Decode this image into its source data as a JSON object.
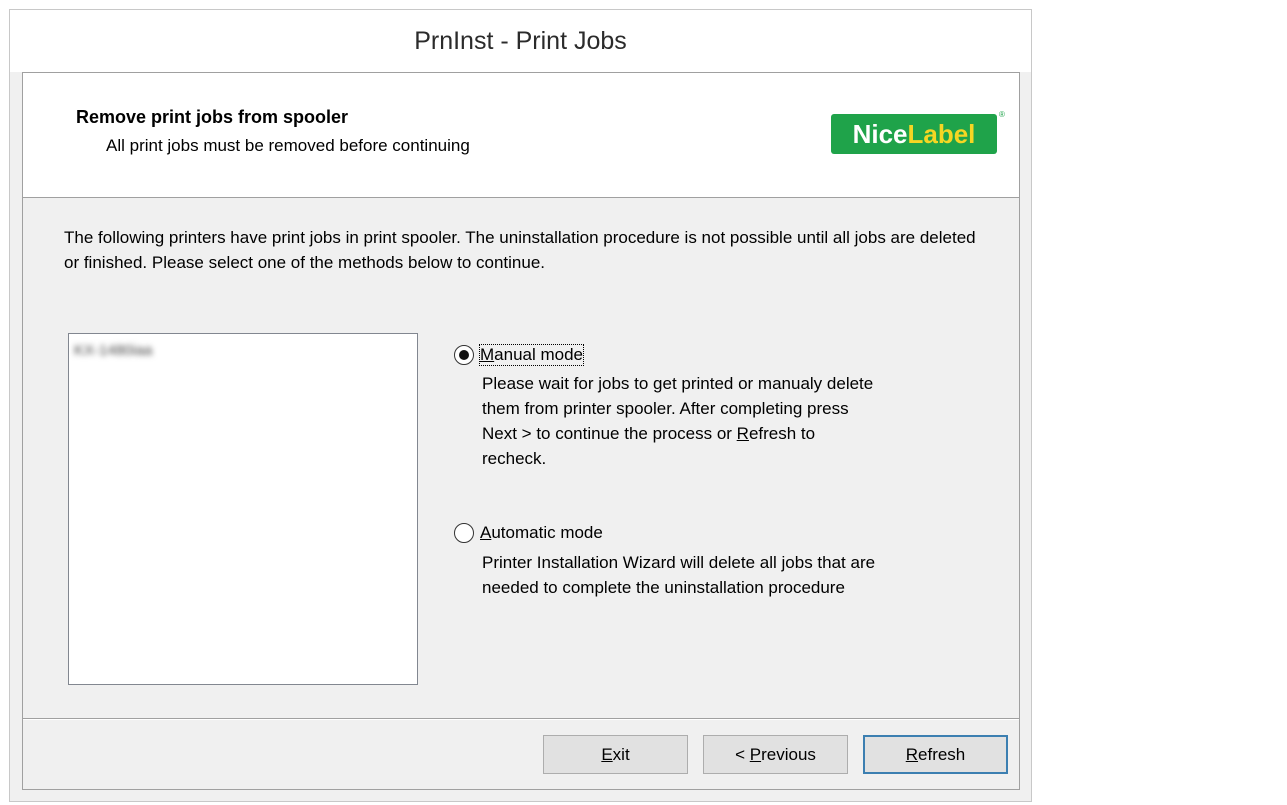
{
  "window": {
    "title": "PrnInst - Print Jobs"
  },
  "header": {
    "title": "Remove print jobs from spooler",
    "subtitle": "All print jobs must be removed before continuing",
    "logo_part1": "Nice",
    "logo_part2": "Label",
    "logo_reg": "®"
  },
  "intro_text": "The following printers have print jobs in print spooler. The uninstallation procedure is not possible until all jobs are deleted or finished. Please select one of the methods below to continue.",
  "printers": [
    {
      "name": "KX-1480iaa"
    }
  ],
  "options": {
    "manual": {
      "mnemonic": "M",
      "rest": "anual mode",
      "selected": true,
      "desc_line1": "Please wait for jobs to get printed or manualy delete",
      "desc_line2": "them from printer spooler. After completing press",
      "desc_line3_pre": "Next > to continue the process or ",
      "desc_line3_mn": "R",
      "desc_line3_post": "efresh to",
      "desc_line4": "recheck."
    },
    "automatic": {
      "mnemonic": "A",
      "rest": "utomatic mode",
      "selected": false,
      "desc_line1": "Printer Installation Wizard will delete all jobs that are",
      "desc_line2": "needed to complete the uninstallation procedure"
    }
  },
  "buttons": {
    "exit_mn": "E",
    "exit_rest": "xit",
    "prev_pre": "< ",
    "prev_mn": "P",
    "prev_rest": "revious",
    "refresh_mn": "R",
    "refresh_rest": "efresh"
  },
  "colors": {
    "logo_green": "#1fa34a",
    "logo_yellow": "#f5d623",
    "default_button_border": "#3c7fb1"
  }
}
